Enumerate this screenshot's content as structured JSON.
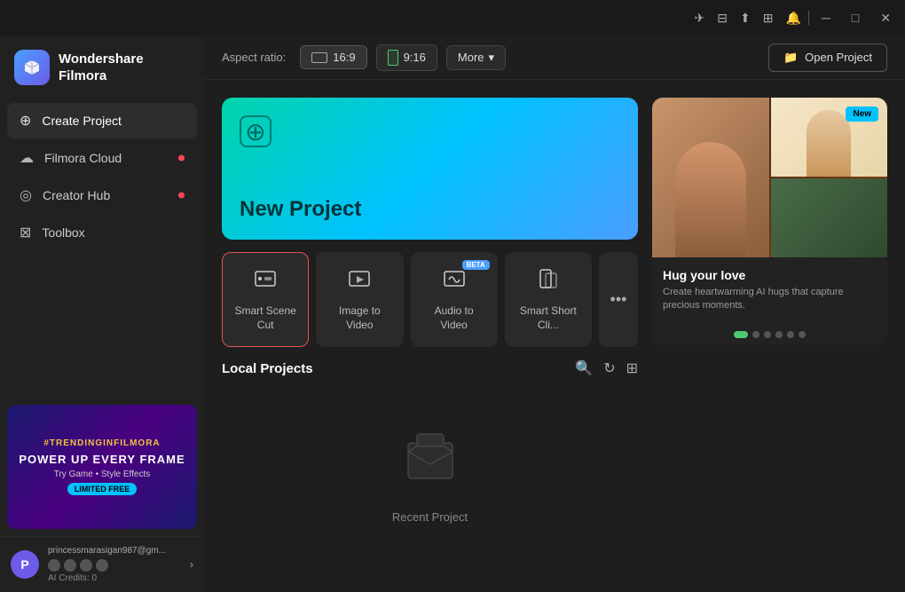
{
  "titlebar": {
    "icons": [
      "share-icon",
      "screen-icon",
      "upload-icon",
      "grid-icon",
      "bell-icon"
    ],
    "windowControls": [
      "minimize-btn",
      "maximize-btn",
      "close-btn"
    ]
  },
  "logo": {
    "name": "Wondershare",
    "subname": "Filmora"
  },
  "sidebar": {
    "items": [
      {
        "id": "create-project",
        "label": "Create Project",
        "active": true,
        "hasDot": false
      },
      {
        "id": "filmora-cloud",
        "label": "Filmora Cloud",
        "active": false,
        "hasDot": true
      },
      {
        "id": "creator-hub",
        "label": "Creator Hub",
        "active": false,
        "hasDot": true
      },
      {
        "id": "toolbox",
        "label": "Toolbox",
        "active": false,
        "hasDot": false
      }
    ],
    "banner": {
      "hashtag": "#TRENDINGINFILMORA",
      "title": "POWER UP EVERY FRAME",
      "subtitle": "Try Game • Style Effects",
      "badge": "LIMITED FREE"
    }
  },
  "user": {
    "avatar": "P",
    "email": "princessmarasigan987@gm...",
    "credits": "AI Credits: 0"
  },
  "toolbar": {
    "aspectRatioLabel": "Aspect ratio:",
    "btn16x9": "16:9",
    "btn9x16": "9:16",
    "moreBtn": "More",
    "openProjectBtn": "Open Project"
  },
  "newProject": {
    "label": "New Project"
  },
  "tools": [
    {
      "id": "smart-scene-cut",
      "label": "Smart Scene Cut",
      "icon": "⊡",
      "badge": null,
      "selected": true
    },
    {
      "id": "image-to-video",
      "label": "Image to Video",
      "icon": "⊡",
      "badge": null,
      "selected": false
    },
    {
      "id": "audio-to-video",
      "label": "Audio to Video",
      "icon": "⊡",
      "badge": "BETA",
      "selected": false
    },
    {
      "id": "smart-short-clip",
      "label": "Smart Short Cli...",
      "icon": "⊡",
      "badge": null,
      "selected": false
    }
  ],
  "localProjects": {
    "title": "Local Projects",
    "emptyLabel": "Recent Project"
  },
  "featured": {
    "badge": "New",
    "title": "Hug your love",
    "description": "Create heartwarming AI hugs that capture precious moments.",
    "dots": [
      true,
      false,
      false,
      false,
      false,
      false
    ]
  }
}
